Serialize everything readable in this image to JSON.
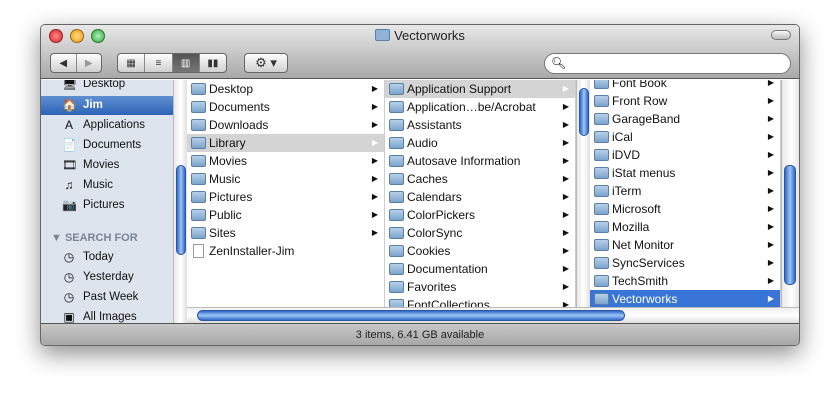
{
  "window": {
    "title": "Vectorworks"
  },
  "toolbar": {
    "back": "◀",
    "forward": "▶",
    "views": [
      "icon-view",
      "list-view",
      "column-view",
      "coverflow-view"
    ],
    "action": "⚙ ▾",
    "search_placeholder": ""
  },
  "sidebar": {
    "places": [
      {
        "label": "Desktop",
        "icon": "🖥"
      },
      {
        "label": "Jim",
        "icon": "🏠",
        "selected": true
      },
      {
        "label": "Applications",
        "icon": "A"
      },
      {
        "label": "Documents",
        "icon": "📄"
      },
      {
        "label": "Movies",
        "icon": "🎞"
      },
      {
        "label": "Music",
        "icon": "♫"
      },
      {
        "label": "Pictures",
        "icon": "📷"
      }
    ],
    "search_header": "▼ SEARCH FOR",
    "searches": [
      {
        "label": "Today",
        "icon": "◷"
      },
      {
        "label": "Yesterday",
        "icon": "◷"
      },
      {
        "label": "Past Week",
        "icon": "◷"
      },
      {
        "label": "All Images",
        "icon": "▣"
      }
    ]
  },
  "columns": [
    {
      "items": [
        {
          "label": "Desktop",
          "arrow": true
        },
        {
          "label": "Documents",
          "arrow": true
        },
        {
          "label": "Downloads",
          "arrow": true
        },
        {
          "label": "Library",
          "arrow": true,
          "state": "gray"
        },
        {
          "label": "Movies",
          "arrow": true
        },
        {
          "label": "Music",
          "arrow": true
        },
        {
          "label": "Pictures",
          "arrow": true
        },
        {
          "label": "Public",
          "arrow": true
        },
        {
          "label": "Sites",
          "arrow": true
        },
        {
          "label": "ZenInstaller-Jim",
          "arrow": false,
          "file": true
        }
      ]
    },
    {
      "items": [
        {
          "label": "Application Support",
          "arrow": true,
          "state": "gray"
        },
        {
          "label": "Application…be/Acrobat",
          "arrow": true
        },
        {
          "label": "Assistants",
          "arrow": true
        },
        {
          "label": "Audio",
          "arrow": true
        },
        {
          "label": "Autosave Information",
          "arrow": true
        },
        {
          "label": "Caches",
          "arrow": true
        },
        {
          "label": "Calendars",
          "arrow": true
        },
        {
          "label": "ColorPickers",
          "arrow": true
        },
        {
          "label": "ColorSync",
          "arrow": true
        },
        {
          "label": "Cookies",
          "arrow": true
        },
        {
          "label": "Documentation",
          "arrow": true
        },
        {
          "label": "Favorites",
          "arrow": true
        },
        {
          "label": "FontCollections",
          "arrow": true
        }
      ]
    },
    {
      "items": [
        {
          "label": "Font Book",
          "arrow": true
        },
        {
          "label": "Front Row",
          "arrow": true
        },
        {
          "label": "GarageBand",
          "arrow": true
        },
        {
          "label": "iCal",
          "arrow": true
        },
        {
          "label": "iDVD",
          "arrow": true
        },
        {
          "label": "iStat menus",
          "arrow": true
        },
        {
          "label": "iTerm",
          "arrow": true
        },
        {
          "label": "Microsoft",
          "arrow": true
        },
        {
          "label": "Mozilla",
          "arrow": true
        },
        {
          "label": "Net Monitor",
          "arrow": true
        },
        {
          "label": "SyncServices",
          "arrow": true
        },
        {
          "label": "TechSmith",
          "arrow": true
        },
        {
          "label": "Vectorworks",
          "arrow": true,
          "state": "blue"
        }
      ]
    }
  ],
  "status": "3 items, 6.41 GB available"
}
